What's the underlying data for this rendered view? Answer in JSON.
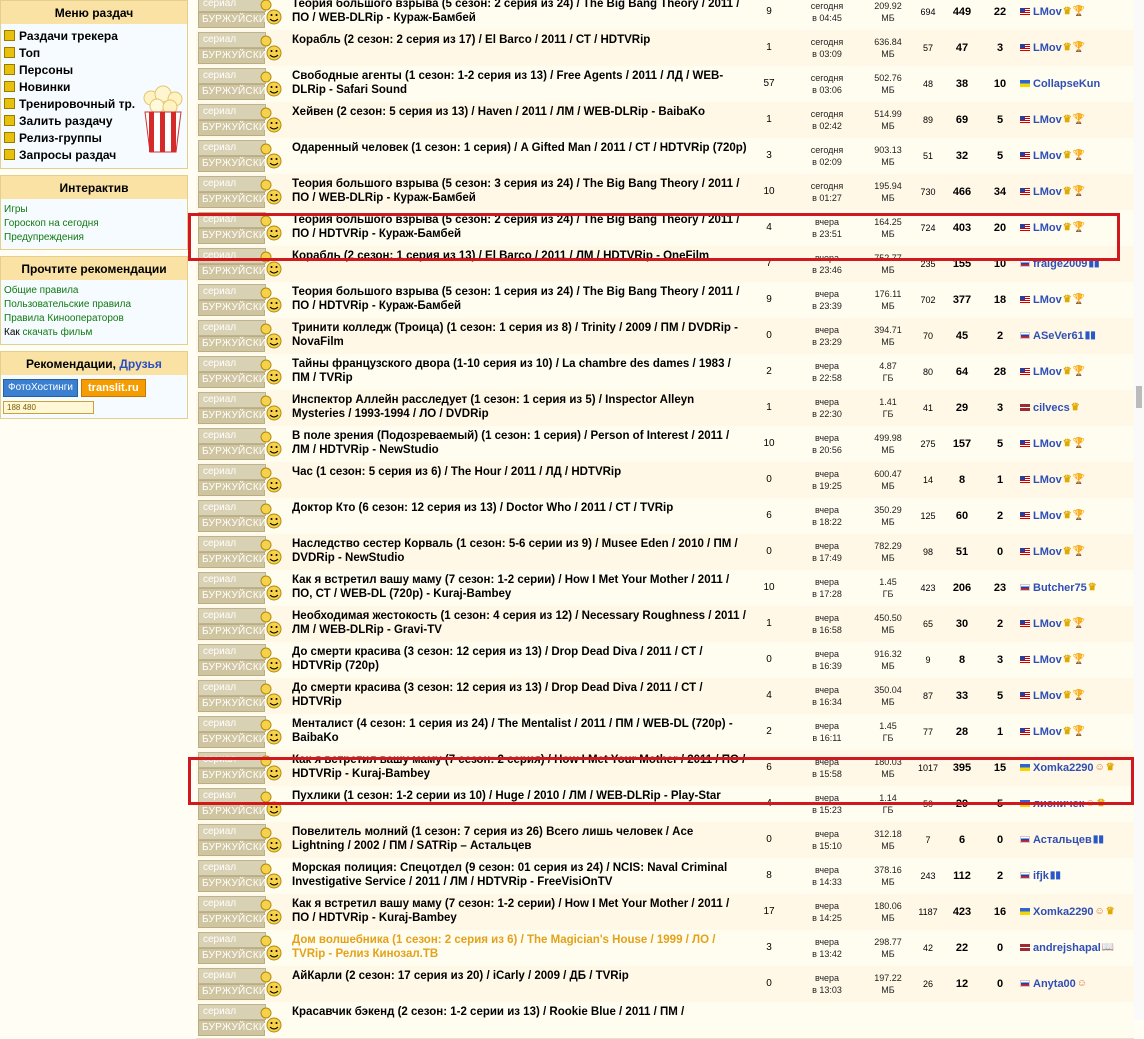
{
  "sidebar": {
    "menu_title": "Меню раздач",
    "menu_items": [
      "Раздачи трекера",
      "Топ",
      "Персоны",
      "Новинки",
      "Тренировочный тр.",
      "Залить раздачу",
      "Релиз-группы",
      "Запросы раздач"
    ],
    "interactive_title": "Интерактив",
    "interactive_items": [
      "Игры",
      "Гороскоп на сегодня",
      "Предупреждения"
    ],
    "rules_title": "Прочтите рекомендации",
    "rules_items": [
      "Общие правила",
      "Пользовательские правила",
      "Правила Кинооператоров"
    ],
    "rules_last_prefix": "Как",
    "rules_last_link": "скачать фильм",
    "recs_title": "Рекомендации,",
    "recs_link": "Друзья",
    "btn_foto": "ФотоХостинги",
    "btn_translit": "translit.ru",
    "counter": "188 480"
  },
  "category": {
    "top": "сериал",
    "bottom": "БУРЖУЙСКИЙ"
  },
  "rows": [
    {
      "title": "Теория большого взрыва (5 сезон: 2 серия из 24) / The Big Bang Theory / 2011 / ПО / WEB-DLRip - Кураж-Бамбей",
      "files": "9",
      "date1": "сегодня",
      "date2": "в 04:45",
      "size1": "209.92",
      "size2": "МБ",
      "com": "694",
      "seed": "449",
      "leech": "22",
      "user": "LMov",
      "flag": "us",
      "badges": [
        "crown",
        "cup"
      ],
      "gold": false
    },
    {
      "title": "Корабль (2 сезон: 2 серия из 17) / El Barco / 2011 / СТ / HDTVRip",
      "files": "1",
      "date1": "сегодня",
      "date2": "в 03:09",
      "size1": "636.84",
      "size2": "МБ",
      "com": "57",
      "seed": "47",
      "leech": "3",
      "user": "LMov",
      "flag": "us",
      "badges": [
        "crown",
        "cup"
      ],
      "gold": false
    },
    {
      "title": "Свободные агенты (1 сезон: 1-2 серия из 13) / Free Agents / 2011 / ЛД / WEB-DLRip - Safari Sound",
      "files": "57",
      "date1": "сегодня",
      "date2": "в 03:06",
      "size1": "502.76",
      "size2": "МБ",
      "com": "48",
      "seed": "38",
      "leech": "10",
      "user": "CollapseKun",
      "flag": "ua",
      "badges": [],
      "gold": false
    },
    {
      "title": "Хейвен (2 сезон: 5 серия из 13) / Haven / 2011 / ЛМ / WEB-DLRip - BaibaKo",
      "files": "1",
      "date1": "сегодня",
      "date2": "в 02:42",
      "size1": "514.99",
      "size2": "МБ",
      "com": "89",
      "seed": "69",
      "leech": "5",
      "user": "LMov",
      "flag": "us",
      "badges": [
        "crown",
        "cup"
      ],
      "gold": false
    },
    {
      "title": "Одаренный человек (1 сезон: 1 серия) / A Gifted Man / 2011 / СТ / HDTVRip (720p)",
      "files": "3",
      "date1": "сегодня",
      "date2": "в 02:09",
      "size1": "903.13",
      "size2": "МБ",
      "com": "51",
      "seed": "32",
      "leech": "5",
      "user": "LMov",
      "flag": "us",
      "badges": [
        "crown",
        "cup"
      ],
      "gold": false
    },
    {
      "title": "Теория большого взрыва (5 сезон: 3 серия из 24) / The Big Bang Theory / 2011 / ПО / WEB-DLRip - Кураж-Бамбей",
      "files": "10",
      "date1": "сегодня",
      "date2": "в 01:27",
      "size1": "195.94",
      "size2": "МБ",
      "com": "730",
      "seed": "466",
      "leech": "34",
      "user": "LMov",
      "flag": "us",
      "badges": [
        "crown",
        "cup"
      ],
      "gold": false
    },
    {
      "title": "Теория большого взрыва (5 сезон: 2 серия из 24) / The Big Bang Theory / 2011 / ПО / HDTVRip - Кураж-Бамбей",
      "files": "4",
      "date1": "вчера",
      "date2": "в 23:51",
      "size1": "164.25",
      "size2": "МБ",
      "com": "724",
      "seed": "403",
      "leech": "20",
      "user": "LMov",
      "flag": "us",
      "badges": [
        "crown",
        "cup"
      ],
      "gold": false
    },
    {
      "title": "Корабль (2 сезон: 1 серия из 13) / El Barco / 2011 / ЛМ / HDTVRip - OneFilm",
      "files": "7",
      "date1": "вчера",
      "date2": "в 23:46",
      "size1": "752.77",
      "size2": "МБ",
      "com": "235",
      "seed": "155",
      "leech": "10",
      "user": "fraige2009",
      "flag": "ru",
      "badges": [
        "film"
      ],
      "gold": false
    },
    {
      "title": "Теория большого взрыва (5 сезон: 1 серия из 24) / The Big Bang Theory / 2011 / ПО / HDTVRip - Кураж-Бамбей",
      "files": "9",
      "date1": "вчера",
      "date2": "в 23:39",
      "size1": "176.11",
      "size2": "МБ",
      "com": "702",
      "seed": "377",
      "leech": "18",
      "user": "LMov",
      "flag": "us",
      "badges": [
        "crown",
        "cup"
      ],
      "gold": false
    },
    {
      "title": "Тринити колледж (Троица) (1 сезон: 1 серия из 8) / Trinity / 2009 / ПМ / DVDRip - NovaFilm",
      "files": "0",
      "date1": "вчера",
      "date2": "в 23:29",
      "size1": "394.71",
      "size2": "МБ",
      "com": "70",
      "seed": "45",
      "leech": "2",
      "user": "ASeVer61",
      "flag": "ru",
      "badges": [
        "film"
      ],
      "gold": false
    },
    {
      "title": "Тайны французского двора (1-10 серия из 10) / La chambre des dames / 1983 / ПМ / TVRip",
      "files": "2",
      "date1": "вчера",
      "date2": "в 22:58",
      "size1": "4.87",
      "size2": "ГБ",
      "com": "80",
      "seed": "64",
      "leech": "28",
      "user": "LMov",
      "flag": "us",
      "badges": [
        "crown",
        "cup"
      ],
      "gold": false
    },
    {
      "title": "Инспектор Аллейн расследует (1 сезон: 1 серия из 5) / Inspector Alleyn Mysteries / 1993-1994 / ЛО / DVDRip",
      "files": "1",
      "date1": "вчера",
      "date2": "в 22:30",
      "size1": "1.41",
      "size2": "ГБ",
      "com": "41",
      "seed": "29",
      "leech": "3",
      "user": "cilvecs",
      "flag": "lv",
      "badges": [
        "crown"
      ],
      "gold": false
    },
    {
      "title": "В поле зрения (Подозреваемый) (1 сезон: 1 серия) / Person of Interest / 2011 / ЛМ / HDTVRip - NewStudio",
      "files": "10",
      "date1": "вчера",
      "date2": "в 20:56",
      "size1": "499.98",
      "size2": "МБ",
      "com": "275",
      "seed": "157",
      "leech": "5",
      "user": "LMov",
      "flag": "us",
      "badges": [
        "crown",
        "cup"
      ],
      "gold": false
    },
    {
      "title": "Час (1 сезон: 5 серия из 6) / The Hour / 2011 / ЛД / HDTVRip",
      "files": "0",
      "date1": "вчера",
      "date2": "в 19:25",
      "size1": "600.47",
      "size2": "МБ",
      "com": "14",
      "seed": "8",
      "leech": "1",
      "user": "LMov",
      "flag": "us",
      "badges": [
        "crown",
        "cup"
      ],
      "gold": false
    },
    {
      "title": "Доктор Кто (6 сезон: 12 серия из 13) / Doctor Who / 2011 / СТ / TVRip",
      "files": "6",
      "date1": "вчера",
      "date2": "в 18:22",
      "size1": "350.29",
      "size2": "МБ",
      "com": "125",
      "seed": "60",
      "leech": "2",
      "user": "LMov",
      "flag": "us",
      "badges": [
        "crown",
        "cup"
      ],
      "gold": false
    },
    {
      "title": "Наследство сестер Корваль (1 сезон: 5-6 серии из 9) / Musee Eden / 2010 / ПМ / DVDRip - NewStudio",
      "files": "0",
      "date1": "вчера",
      "date2": "в 17:49",
      "size1": "782.29",
      "size2": "МБ",
      "com": "98",
      "seed": "51",
      "leech": "0",
      "user": "LMov",
      "flag": "us",
      "badges": [
        "crown",
        "cup"
      ],
      "gold": false
    },
    {
      "title": "Как я встретил вашу маму (7 сезон: 1-2 серии) / How I Met Your Mother / 2011 / ПО, СТ / WEB-DL (720p) - Kuraj-Bambey",
      "files": "10",
      "date1": "вчера",
      "date2": "в 17:28",
      "size1": "1.45",
      "size2": "ГБ",
      "com": "423",
      "seed": "206",
      "leech": "23",
      "user": "Butcher75",
      "flag": "ru",
      "badges": [
        "crown"
      ],
      "gold": false
    },
    {
      "title": "Необходимая жестокость (1 сезон: 4 серия из 12) / Necessary Roughness / 2011 / ЛМ / WEB-DLRip - Gravi-TV",
      "files": "1",
      "date1": "вчера",
      "date2": "в 16:58",
      "size1": "450.50",
      "size2": "МБ",
      "com": "65",
      "seed": "30",
      "leech": "2",
      "user": "LMov",
      "flag": "us",
      "badges": [
        "crown",
        "cup"
      ],
      "gold": false
    },
    {
      "title": "До смерти красива (3 сезон: 12 серия из 13) / Drop Dead Diva / 2011 / СТ / HDTVRip (720p)",
      "files": "0",
      "date1": "вчера",
      "date2": "в 16:39",
      "size1": "916.32",
      "size2": "МБ",
      "com": "9",
      "seed": "8",
      "leech": "3",
      "user": "LMov",
      "flag": "us",
      "badges": [
        "crown",
        "cup"
      ],
      "gold": false
    },
    {
      "title": "До смерти красива (3 сезон: 12 серия из 13) / Drop Dead Diva / 2011 / СТ / HDTVRip",
      "files": "4",
      "date1": "вчера",
      "date2": "в 16:34",
      "size1": "350.04",
      "size2": "МБ",
      "com": "87",
      "seed": "33",
      "leech": "5",
      "user": "LMov",
      "flag": "us",
      "badges": [
        "crown",
        "cup"
      ],
      "gold": false
    },
    {
      "title": "Менталист (4 сезон: 1 серия из 24) / The Mentalist / 2011 / ПМ / WEB-DL (720p) - BaibaKo",
      "files": "2",
      "date1": "вчера",
      "date2": "в 16:11",
      "size1": "1.45",
      "size2": "ГБ",
      "com": "77",
      "seed": "28",
      "leech": "1",
      "user": "LMov",
      "flag": "us",
      "badges": [
        "crown",
        "cup"
      ],
      "gold": false
    },
    {
      "title": "Как я встретил вашу маму (7 сезон: 2 серия) / How I Met Your Mother / 2011 / ПО / HDTVRip - Kuraj-Bambey",
      "files": "6",
      "date1": "вчера",
      "date2": "в 15:58",
      "size1": "180.03",
      "size2": "МБ",
      "com": "1017",
      "seed": "395",
      "leech": "15",
      "user": "Xomka2290",
      "flag": "ua",
      "badges": [
        "girl",
        "crown"
      ],
      "gold": false
    },
    {
      "title": "Пухлики (1 сезон: 1-2 серии из 10) / Huge / 2010 / ЛМ / WEB-DLRip - Play-Star",
      "files": "4",
      "date1": "вчера",
      "date2": "в 15:23",
      "size1": "1.14",
      "size2": "ГБ",
      "com": "50",
      "seed": "29",
      "leech": "5",
      "user": "лисничек",
      "flag": "ua",
      "badges": [
        "girl",
        "crown"
      ],
      "gold": false
    },
    {
      "title": "Повелитель молний (1 сезон: 7 серия из 26) Всего лишь человек / Ace Lightning / 2002 / ПМ / SATRip – Астальцев",
      "files": "0",
      "date1": "вчера",
      "date2": "в 15:10",
      "size1": "312.18",
      "size2": "МБ",
      "com": "7",
      "seed": "6",
      "leech": "0",
      "user": "Астальцев",
      "flag": "ru",
      "badges": [
        "film"
      ],
      "gold": false
    },
    {
      "title": "Морская полиция: Спецотдел (9 сезон: 01 серия из 24) / NCIS: Naval Criminal Investigative Service / 2011 / ЛМ / HDTVRip - FreeVisiOnTV",
      "files": "8",
      "date1": "вчера",
      "date2": "в 14:33",
      "size1": "378.16",
      "size2": "МБ",
      "com": "243",
      "seed": "112",
      "leech": "2",
      "user": "ifjk",
      "flag": "ru",
      "badges": [
        "film"
      ],
      "gold": false
    },
    {
      "title": "Как я встретил вашу маму (7 сезон: 1-2 серии) / How I Met Your Mother / 2011 / ПО / HDTVRip - Kuraj-Bambey",
      "files": "17",
      "date1": "вчера",
      "date2": "в 14:25",
      "size1": "180.06",
      "size2": "МБ",
      "com": "1187",
      "seed": "423",
      "leech": "16",
      "user": "Xomka2290",
      "flag": "ua",
      "badges": [
        "girl",
        "crown"
      ],
      "gold": false
    },
    {
      "title": "Дом волшебника (1 сезон: 2 серия из 6) / The Magician's House / 1999 / ЛО / TVRip - Релиз Кинозал.ТВ",
      "files": "3",
      "date1": "вчера",
      "date2": "в 13:42",
      "size1": "298.77",
      "size2": "МБ",
      "com": "42",
      "seed": "22",
      "leech": "0",
      "user": "andrejshapal",
      "flag": "lv",
      "badges": [
        "book"
      ],
      "gold": true
    },
    {
      "title": "АйКарли (2 сезон: 17 серия из 20) / iCarly / 2009 / ДБ / TVRip",
      "files": "0",
      "date1": "вчера",
      "date2": "в 13:03",
      "size1": "197.22",
      "size2": "МБ",
      "com": "26",
      "seed": "12",
      "leech": "0",
      "user": "Anyta00",
      "flag": "ru",
      "badges": [
        "girl"
      ],
      "gold": false
    },
    {
      "title": "Красавчик бэкенд (2 сезон: 1-2 серии из 13) / Rookie Blue / 2011 / ПМ /",
      "files": "",
      "date1": "",
      "date2": "",
      "size1": "",
      "size2": "",
      "com": "",
      "seed": "",
      "leech": "",
      "user": "",
      "flag": "",
      "badges": [],
      "gold": false
    }
  ]
}
